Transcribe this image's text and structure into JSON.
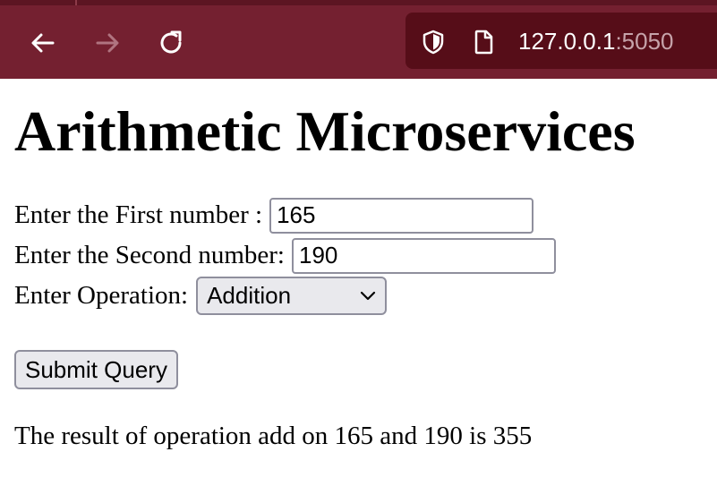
{
  "browser": {
    "url_host": "127.0.0.1",
    "url_port": ":5050",
    "icons": {
      "back": "back-arrow-icon",
      "forward": "forward-arrow-icon",
      "reload": "reload-icon",
      "shield": "shield-icon",
      "page": "page-icon"
    },
    "colors": {
      "toolbar": "#742030",
      "urlbar": "#560d18"
    }
  },
  "page": {
    "title": "Arithmetic Microservices",
    "form": {
      "first_label": "Enter the First number :",
      "first_value": "165",
      "second_label": "Enter the Second number:",
      "second_value": "190",
      "operation_label": "Enter Operation:",
      "operation_selected": "Addition",
      "submit_label": "Submit Query"
    },
    "result": "The result of operation add on 165 and 190 is 355"
  }
}
